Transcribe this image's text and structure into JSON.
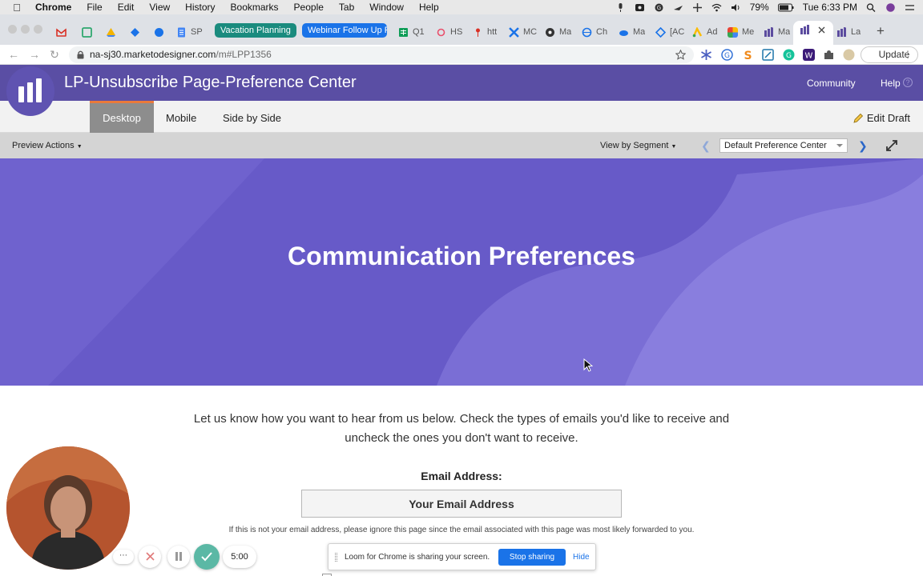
{
  "menubar": {
    "items": [
      "Chrome",
      "File",
      "Edit",
      "View",
      "History",
      "Bookmarks",
      "People",
      "Tab",
      "Window",
      "Help"
    ],
    "battery": "79%",
    "clock": "Tue 6:33 PM"
  },
  "tabs": {
    "group_vacation": "Vacation Planning",
    "group_webinar": "Webinar Follow Up F",
    "items": [
      "SP",
      "Q1",
      "HS",
      "htt",
      "MC",
      "Ma",
      "Ch",
      "Ma",
      "[AC",
      "Ad",
      "Me",
      "Ma",
      "La"
    ],
    "new_tab": "+"
  },
  "address": {
    "domain": "na-sj30.marketodesigner.com",
    "path": "/m#LPP1356",
    "update_label": "Update"
  },
  "app": {
    "title": "LP-Unsubscribe Page-Preference Center",
    "community": "Community",
    "help": "Help"
  },
  "view_tabs": [
    "Desktop",
    "Mobile",
    "Side by Side"
  ],
  "edit_draft": "Edit Draft",
  "preview": {
    "actions": "Preview Actions",
    "view_by_segment": "View by Segment",
    "segment_value": "Default Preference Center"
  },
  "page": {
    "hero_title": "Communication Preferences",
    "intro": "Let us know how you want to hear from us below. Check the types of emails you'd like to receive and uncheck the ones you don't want to receive.",
    "email_label": "Email Address:",
    "email_value": "Your Email Address",
    "notice": "If this is not your email address, please ignore this page since the email associated with this page was most likely forwarded to you."
  },
  "loom": {
    "timer": "5:00",
    "message": "Loom for Chrome is sharing your screen.",
    "stop_sharing": "Stop sharing",
    "hide": "Hide"
  },
  "colors": {
    "marketo_purple": "#5a4ea4",
    "hero_purple": "#675ac8",
    "accent_orange": "#e97a3c",
    "tab_group_teal": "#1a8b7e",
    "tab_group_blue": "#1a73e8"
  }
}
